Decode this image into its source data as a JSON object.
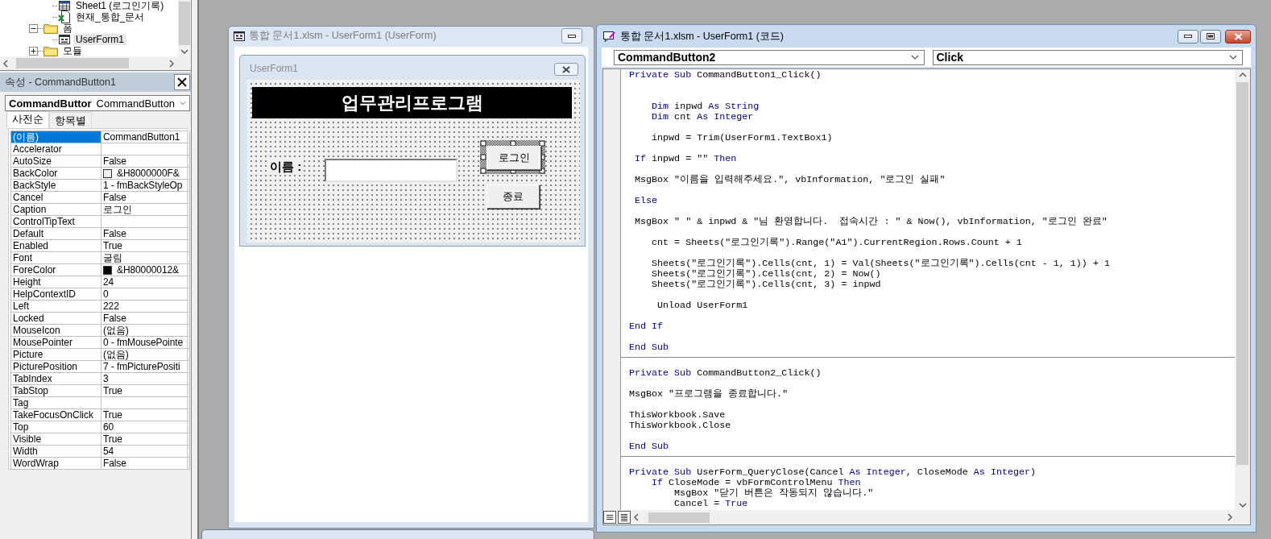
{
  "project_tree": {
    "items": [
      {
        "children": [
          {
            "label": "Sheet1 (로그인기록)",
            "kind": "sheet",
            "selected": false
          },
          {
            "label": "현재_통합_문서",
            "kind": "workbook",
            "selected": false
          }
        ]
      },
      {
        "label": "폼",
        "kind": "folder",
        "expanded": true,
        "selected": false,
        "children": [
          {
            "label": "UserForm1",
            "kind": "form",
            "selected": true
          }
        ]
      },
      {
        "label": "모듈",
        "kind": "folder",
        "expanded": false,
        "selected": false
      }
    ]
  },
  "properties": {
    "title": "속성 - CommandButton1",
    "object": {
      "name": "CommandButtor",
      "type": "CommandButton"
    },
    "tabs": [
      {
        "label": "사전순",
        "selected": true
      },
      {
        "label": "항목별",
        "selected": false
      }
    ],
    "rows": [
      {
        "name": "(이름)",
        "value": "CommandButton1",
        "selected": true
      },
      {
        "name": "Accelerator",
        "selected": false
      },
      {
        "name": "AutoSize",
        "value": "False",
        "selected": false
      },
      {
        "name": "BackColor",
        "value": "&H8000000F&",
        "color": "#f0f0f0",
        "selected": false
      },
      {
        "name": "BackStyle",
        "value": "1 - fmBackStyleOp",
        "selected": false
      },
      {
        "name": "Cancel",
        "value": "False",
        "selected": false
      },
      {
        "name": "Caption",
        "value": "로그인",
        "selected": false
      },
      {
        "name": "ControlTipText",
        "selected": false
      },
      {
        "name": "Default",
        "value": "False",
        "selected": false
      },
      {
        "name": "Enabled",
        "value": "True",
        "selected": false
      },
      {
        "name": "Font",
        "value": "굴림",
        "selected": false
      },
      {
        "name": "ForeColor",
        "value": "&H80000012&",
        "color": "#000000",
        "selected": false
      },
      {
        "name": "Height",
        "value": "24",
        "selected": false
      },
      {
        "name": "HelpContextID",
        "value": "0",
        "selected": false
      },
      {
        "name": "Left",
        "value": "222",
        "selected": false
      },
      {
        "name": "Locked",
        "value": "False",
        "selected": false
      },
      {
        "name": "MouseIcon",
        "value": "(없음)",
        "selected": false
      },
      {
        "name": "MousePointer",
        "value": "0 - fmMousePointe",
        "selected": false
      },
      {
        "name": "Picture",
        "value": "(없음)",
        "selected": false
      },
      {
        "name": "PicturePosition",
        "value": "7 - fmPicturePositi",
        "selected": false
      },
      {
        "name": "TabIndex",
        "value": "3",
        "selected": false
      },
      {
        "name": "TabStop",
        "value": "True",
        "selected": false
      },
      {
        "name": "Tag",
        "selected": false
      },
      {
        "name": "TakeFocusOnClick",
        "value": "True",
        "selected": false
      },
      {
        "name": "Top",
        "value": "60",
        "selected": false
      },
      {
        "name": "Visible",
        "value": "True",
        "selected": false
      },
      {
        "name": "Width",
        "value": "54",
        "selected": false
      },
      {
        "name": "WordWrap",
        "value": "False",
        "selected": false
      }
    ]
  },
  "form_window": {
    "title": "통합 문서1.xlsm - UserForm1 (UserForm)",
    "active": false,
    "form": {
      "caption": "UserForm1",
      "heading": "업무관리프로그램",
      "name_label": "이름 :",
      "buttons": [
        {
          "label": "로그인",
          "selected": true
        },
        {
          "label": "종료",
          "selected": false
        }
      ]
    }
  },
  "code_window": {
    "title": "통합 문서1.xlsm - UserForm1 (코드)",
    "active": true,
    "object_dropdown": "CommandButton2",
    "procedure_dropdown": "Click",
    "procedures": [
      {
        "lines": [
          {
            "kind": "code",
            "segments": [
              {
                "text": "Private Sub",
                "keyword": true
              },
              {
                "text": " CommandButton1_Click()",
                "keyword": false
              }
            ]
          },
          {
            "kind": "blank"
          },
          {
            "kind": "blank"
          },
          {
            "kind": "code",
            "segments": [
              {
                "text": "    Dim",
                "keyword": true
              },
              {
                "text": " inpwd ",
                "keyword": false
              },
              {
                "text": "As String",
                "keyword": true
              }
            ]
          },
          {
            "kind": "code",
            "segments": [
              {
                "text": "    Dim",
                "keyword": true
              },
              {
                "text": " cnt ",
                "keyword": false
              },
              {
                "text": "As Integer",
                "keyword": true
              }
            ]
          },
          {
            "kind": "blank"
          },
          {
            "kind": "code",
            "segments": [
              {
                "text": "    inpwd = Trim(UserForm1.TextBox1)",
                "keyword": false
              }
            ]
          },
          {
            "kind": "blank"
          },
          {
            "kind": "code",
            "segments": [
              {
                "text": " If",
                "keyword": true
              },
              {
                "text": " inpwd = \"\" ",
                "keyword": false
              },
              {
                "text": "Then",
                "keyword": true
              }
            ]
          },
          {
            "kind": "blank"
          },
          {
            "kind": "code",
            "segments": [
              {
                "text": " MsgBox \"이름을 입력해주세요.\", vbInformation, \"로그인 실패\"",
                "keyword": false
              }
            ]
          },
          {
            "kind": "blank"
          },
          {
            "kind": "code",
            "segments": [
              {
                "text": " Else",
                "keyword": true
              }
            ]
          },
          {
            "kind": "blank"
          },
          {
            "kind": "code",
            "segments": [
              {
                "text": " MsgBox \" \" & inpwd & \"님 환영합니다.  접속시간 : \" & Now(), vbInformation, \"로그인 완료\"",
                "keyword": false
              }
            ]
          },
          {
            "kind": "blank"
          },
          {
            "kind": "code",
            "segments": [
              {
                "text": "    cnt = Sheets(\"로그인기록\").Range(\"A1\").CurrentRegion.Rows.Count + 1",
                "keyword": false
              }
            ]
          },
          {
            "kind": "blank"
          },
          {
            "kind": "code",
            "segments": [
              {
                "text": "    Sheets(\"로그인기록\").Cells(cnt, 1) = Val(Sheets(\"로그인기록\").Cells(cnt - 1, 1)) + 1",
                "keyword": false
              }
            ]
          },
          {
            "kind": "code",
            "segments": [
              {
                "text": "    Sheets(\"로그인기록\").Cells(cnt, 2) = Now()",
                "keyword": false
              }
            ]
          },
          {
            "kind": "code",
            "segments": [
              {
                "text": "    Sheets(\"로그인기록\").Cells(cnt, 3) = inpwd",
                "keyword": false
              }
            ]
          },
          {
            "kind": "blank"
          },
          {
            "kind": "code",
            "segments": [
              {
                "text": "     Unload UserForm1",
                "keyword": false
              }
            ]
          },
          {
            "kind": "blank"
          },
          {
            "kind": "code",
            "segments": [
              {
                "text": "End If",
                "keyword": true
              }
            ]
          },
          {
            "kind": "blank"
          },
          {
            "kind": "code",
            "segments": [
              {
                "text": "End Sub",
                "keyword": true
              }
            ]
          }
        ]
      },
      {
        "lines": [
          {
            "kind": "code",
            "segments": [
              {
                "text": "Private Sub",
                "keyword": true
              },
              {
                "text": " CommandButton2_Click()",
                "keyword": false
              }
            ]
          },
          {
            "kind": "blank"
          },
          {
            "kind": "code",
            "segments": [
              {
                "text": "MsgBox \"프로그램을 종료합니다.\"",
                "keyword": false
              }
            ]
          },
          {
            "kind": "blank"
          },
          {
            "kind": "code",
            "segments": [
              {
                "text": "ThisWorkbook.Save",
                "keyword": false
              }
            ]
          },
          {
            "kind": "code",
            "segments": [
              {
                "text": "ThisWorkbook.Close",
                "keyword": false
              }
            ]
          },
          {
            "kind": "blank"
          },
          {
            "kind": "code",
            "segments": [
              {
                "text": "End Sub",
                "keyword": true
              }
            ]
          }
        ]
      },
      {
        "lines": [
          {
            "kind": "code",
            "segments": [
              {
                "text": "Private Sub",
                "keyword": true
              },
              {
                "text": " UserForm_QueryClose(Cancel ",
                "keyword": false
              },
              {
                "text": "As Integer",
                "keyword": true
              },
              {
                "text": ", CloseMode ",
                "keyword": false
              },
              {
                "text": "As Integer",
                "keyword": true
              },
              {
                "text": ")",
                "keyword": false
              }
            ]
          },
          {
            "kind": "code",
            "segments": [
              {
                "text": "    If",
                "keyword": true
              },
              {
                "text": " CloseMode = vbFormControlMenu ",
                "keyword": false
              },
              {
                "text": "Then",
                "keyword": true
              }
            ]
          },
          {
            "kind": "code",
            "segments": [
              {
                "text": "        MsgBox \"닫기 버튼은 작동되지 않습니다.\"",
                "keyword": false
              }
            ]
          },
          {
            "kind": "code",
            "segments": [
              {
                "text": "        Cancel = ",
                "keyword": false
              },
              {
                "text": "True",
                "keyword": true
              }
            ]
          }
        ]
      }
    ]
  }
}
